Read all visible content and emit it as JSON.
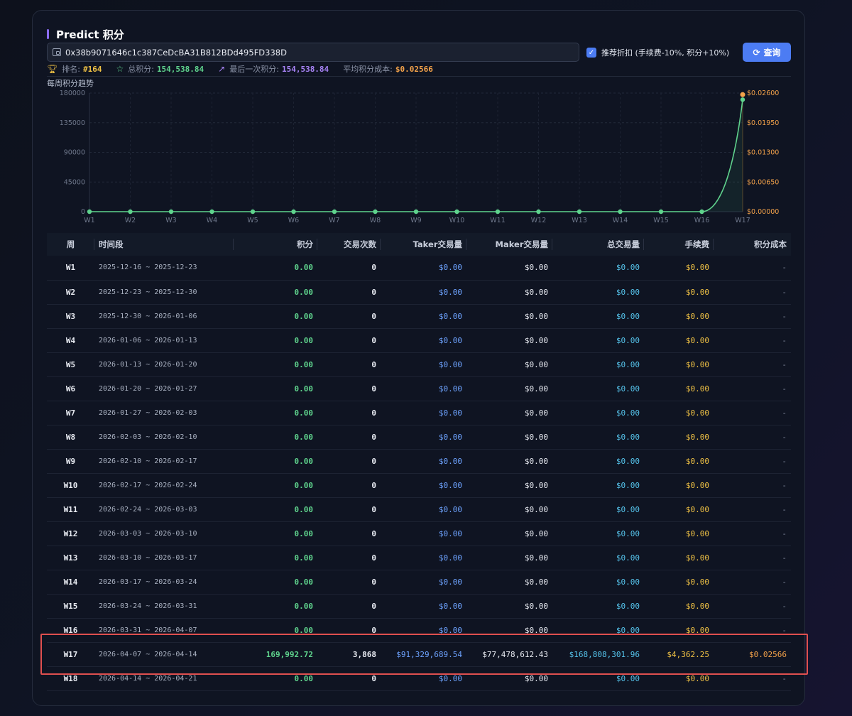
{
  "title": "Predict 积分",
  "address": {
    "value": "0x38b9071646c1c387CeDcBA31B812BDd495FD338D"
  },
  "discount": {
    "label": "推荐折扣 (手续费-10%, 积分+10%)",
    "checked": true
  },
  "query_button": {
    "label": "查询"
  },
  "stats": {
    "rank_label": "排名:",
    "rank_value": "#164",
    "total_label": "总积分:",
    "total_value": "154,538.84",
    "last_label": "最后一次积分:",
    "last_value": "154,538.84",
    "avgcost_label": "平均积分成本:",
    "avgcost_value": "$0.02566"
  },
  "chart_title": "每周积分趋势",
  "chart_data": {
    "type": "line",
    "title": "每周积分趋势",
    "categories": [
      "W1",
      "W2",
      "W3",
      "W4",
      "W5",
      "W6",
      "W7",
      "W8",
      "W9",
      "W10",
      "W11",
      "W12",
      "W13",
      "W14",
      "W15",
      "W16",
      "W17"
    ],
    "series": [
      {
        "values": [
          0,
          0,
          0,
          0,
          0,
          0,
          0,
          0,
          0,
          0,
          0,
          0,
          0,
          0,
          0,
          0,
          169992.72
        ],
        "axis": "left",
        "color": "#5fd38d"
      },
      {
        "values": [
          null,
          null,
          null,
          null,
          null,
          null,
          null,
          null,
          null,
          null,
          null,
          null,
          null,
          null,
          null,
          null,
          0.02566
        ],
        "axis": "right",
        "color": "#f3a24a"
      }
    ],
    "y_left": {
      "range": [
        0,
        180000
      ],
      "ticks": [
        "0",
        "45000",
        "90000",
        "135000",
        "180000"
      ]
    },
    "y_right": {
      "range": [
        0,
        0.026
      ],
      "ticks": [
        "$0.00000",
        "$0.00650",
        "$0.01300",
        "$0.01950",
        "$0.02600"
      ]
    },
    "grid": true
  },
  "table": {
    "headers": [
      "周",
      "时间段",
      "积分",
      "交易次数",
      "Taker交易量",
      "Maker交易量",
      "总交易量",
      "手续费",
      "积分成本"
    ],
    "rows": [
      {
        "week": "W1",
        "period": "2025-12-16 ~ 2025-12-23",
        "points": "0.00",
        "trades": "0",
        "taker": "$0.00",
        "maker": "$0.00",
        "total": "$0.00",
        "fee": "$0.00",
        "cost": "-"
      },
      {
        "week": "W2",
        "period": "2025-12-23 ~ 2025-12-30",
        "points": "0.00",
        "trades": "0",
        "taker": "$0.00",
        "maker": "$0.00",
        "total": "$0.00",
        "fee": "$0.00",
        "cost": "-"
      },
      {
        "week": "W3",
        "period": "2025-12-30 ~ 2026-01-06",
        "points": "0.00",
        "trades": "0",
        "taker": "$0.00",
        "maker": "$0.00",
        "total": "$0.00",
        "fee": "$0.00",
        "cost": "-"
      },
      {
        "week": "W4",
        "period": "2026-01-06 ~ 2026-01-13",
        "points": "0.00",
        "trades": "0",
        "taker": "$0.00",
        "maker": "$0.00",
        "total": "$0.00",
        "fee": "$0.00",
        "cost": "-"
      },
      {
        "week": "W5",
        "period": "2026-01-13 ~ 2026-01-20",
        "points": "0.00",
        "trades": "0",
        "taker": "$0.00",
        "maker": "$0.00",
        "total": "$0.00",
        "fee": "$0.00",
        "cost": "-"
      },
      {
        "week": "W6",
        "period": "2026-01-20 ~ 2026-01-27",
        "points": "0.00",
        "trades": "0",
        "taker": "$0.00",
        "maker": "$0.00",
        "total": "$0.00",
        "fee": "$0.00",
        "cost": "-"
      },
      {
        "week": "W7",
        "period": "2026-01-27 ~ 2026-02-03",
        "points": "0.00",
        "trades": "0",
        "taker": "$0.00",
        "maker": "$0.00",
        "total": "$0.00",
        "fee": "$0.00",
        "cost": "-"
      },
      {
        "week": "W8",
        "period": "2026-02-03 ~ 2026-02-10",
        "points": "0.00",
        "trades": "0",
        "taker": "$0.00",
        "maker": "$0.00",
        "total": "$0.00",
        "fee": "$0.00",
        "cost": "-"
      },
      {
        "week": "W9",
        "period": "2026-02-10 ~ 2026-02-17",
        "points": "0.00",
        "trades": "0",
        "taker": "$0.00",
        "maker": "$0.00",
        "total": "$0.00",
        "fee": "$0.00",
        "cost": "-"
      },
      {
        "week": "W10",
        "period": "2026-02-17 ~ 2026-02-24",
        "points": "0.00",
        "trades": "0",
        "taker": "$0.00",
        "maker": "$0.00",
        "total": "$0.00",
        "fee": "$0.00",
        "cost": "-"
      },
      {
        "week": "W11",
        "period": "2026-02-24 ~ 2026-03-03",
        "points": "0.00",
        "trades": "0",
        "taker": "$0.00",
        "maker": "$0.00",
        "total": "$0.00",
        "fee": "$0.00",
        "cost": "-"
      },
      {
        "week": "W12",
        "period": "2026-03-03 ~ 2026-03-10",
        "points": "0.00",
        "trades": "0",
        "taker": "$0.00",
        "maker": "$0.00",
        "total": "$0.00",
        "fee": "$0.00",
        "cost": "-"
      },
      {
        "week": "W13",
        "period": "2026-03-10 ~ 2026-03-17",
        "points": "0.00",
        "trades": "0",
        "taker": "$0.00",
        "maker": "$0.00",
        "total": "$0.00",
        "fee": "$0.00",
        "cost": "-"
      },
      {
        "week": "W14",
        "period": "2026-03-17 ~ 2026-03-24",
        "points": "0.00",
        "trades": "0",
        "taker": "$0.00",
        "maker": "$0.00",
        "total": "$0.00",
        "fee": "$0.00",
        "cost": "-"
      },
      {
        "week": "W15",
        "period": "2026-03-24 ~ 2026-03-31",
        "points": "0.00",
        "trades": "0",
        "taker": "$0.00",
        "maker": "$0.00",
        "total": "$0.00",
        "fee": "$0.00",
        "cost": "-"
      },
      {
        "week": "W16",
        "period": "2026-03-31 ~ 2026-04-07",
        "points": "0.00",
        "trades": "0",
        "taker": "$0.00",
        "maker": "$0.00",
        "total": "$0.00",
        "fee": "$0.00",
        "cost": "-"
      },
      {
        "week": "W17",
        "period": "2026-04-07 ~ 2026-04-14",
        "points": "169,992.72",
        "trades": "3,868",
        "taker": "$91,329,689.54",
        "maker": "$77,478,612.43",
        "total": "$168,808,301.96",
        "fee": "$4,362.25",
        "cost": "$0.02566",
        "highlight": true
      },
      {
        "week": "W18",
        "period": "2026-04-14 ~ 2026-04-21",
        "points": "0.00",
        "trades": "0",
        "taker": "$0.00",
        "maker": "$0.00",
        "total": "$0.00",
        "fee": "$0.00",
        "cost": "-"
      }
    ]
  }
}
